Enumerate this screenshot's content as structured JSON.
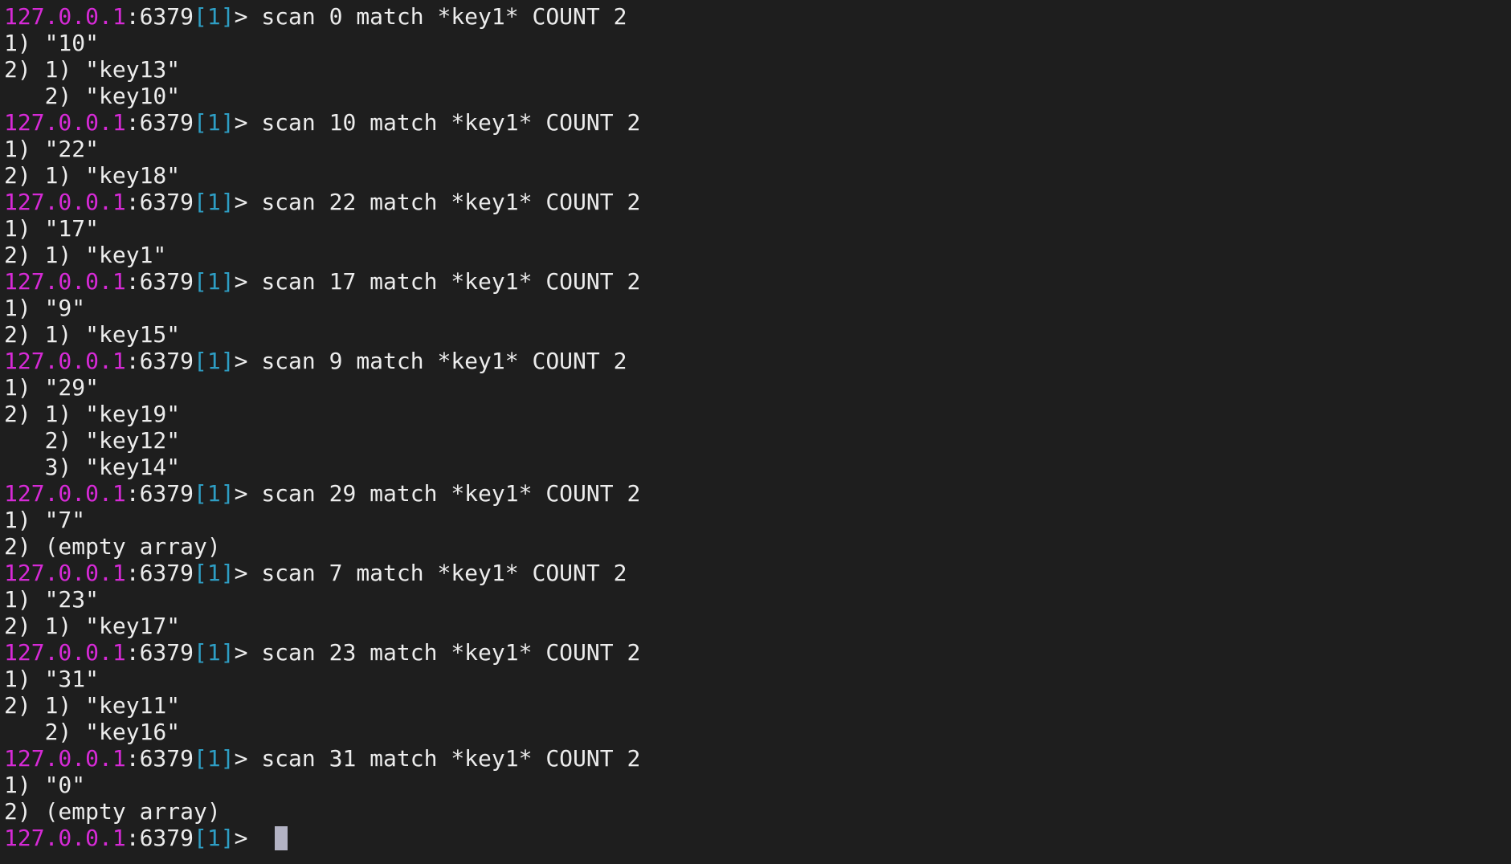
{
  "prompt": {
    "host": "127.0.0.1",
    "port": ":6379",
    "db": "[1]",
    "symbol": "> "
  },
  "colors": {
    "background": "#1e1e1e",
    "text": "#ececec",
    "host": "#d62ad6",
    "db_index": "#2e9ec4",
    "cursor": "#b3b3c4"
  },
  "lines": [
    {
      "type": "cmd",
      "text": "scan 0 match *key1* COUNT 2"
    },
    {
      "type": "out",
      "text": "1) \"10\""
    },
    {
      "type": "out",
      "text": "2) 1) \"key13\""
    },
    {
      "type": "out",
      "text": "   2) \"key10\""
    },
    {
      "type": "cmd",
      "text": "scan 10 match *key1* COUNT 2"
    },
    {
      "type": "out",
      "text": "1) \"22\""
    },
    {
      "type": "out",
      "text": "2) 1) \"key18\""
    },
    {
      "type": "cmd",
      "text": "scan 22 match *key1* COUNT 2"
    },
    {
      "type": "out",
      "text": "1) \"17\""
    },
    {
      "type": "out",
      "text": "2) 1) \"key1\""
    },
    {
      "type": "cmd",
      "text": "scan 17 match *key1* COUNT 2"
    },
    {
      "type": "out",
      "text": "1) \"9\""
    },
    {
      "type": "out",
      "text": "2) 1) \"key15\""
    },
    {
      "type": "cmd",
      "text": "scan 9 match *key1* COUNT 2"
    },
    {
      "type": "out",
      "text": "1) \"29\""
    },
    {
      "type": "out",
      "text": "2) 1) \"key19\""
    },
    {
      "type": "out",
      "text": "   2) \"key12\""
    },
    {
      "type": "out",
      "text": "   3) \"key14\""
    },
    {
      "type": "cmd",
      "text": "scan 29 match *key1* COUNT 2"
    },
    {
      "type": "out",
      "text": "1) \"7\""
    },
    {
      "type": "out",
      "text": "2) (empty array)"
    },
    {
      "type": "cmd",
      "text": "scan 7 match *key1* COUNT 2"
    },
    {
      "type": "out",
      "text": "1) \"23\""
    },
    {
      "type": "out",
      "text": "2) 1) \"key17\""
    },
    {
      "type": "cmd",
      "text": "scan 23 match *key1* COUNT 2"
    },
    {
      "type": "out",
      "text": "1) \"31\""
    },
    {
      "type": "out",
      "text": "2) 1) \"key11\""
    },
    {
      "type": "out",
      "text": "   2) \"key16\""
    },
    {
      "type": "cmd",
      "text": "scan 31 match *key1* COUNT 2"
    },
    {
      "type": "out",
      "text": "1) \"0\""
    },
    {
      "type": "out",
      "text": "2) (empty array)"
    },
    {
      "type": "input",
      "text": ""
    }
  ]
}
